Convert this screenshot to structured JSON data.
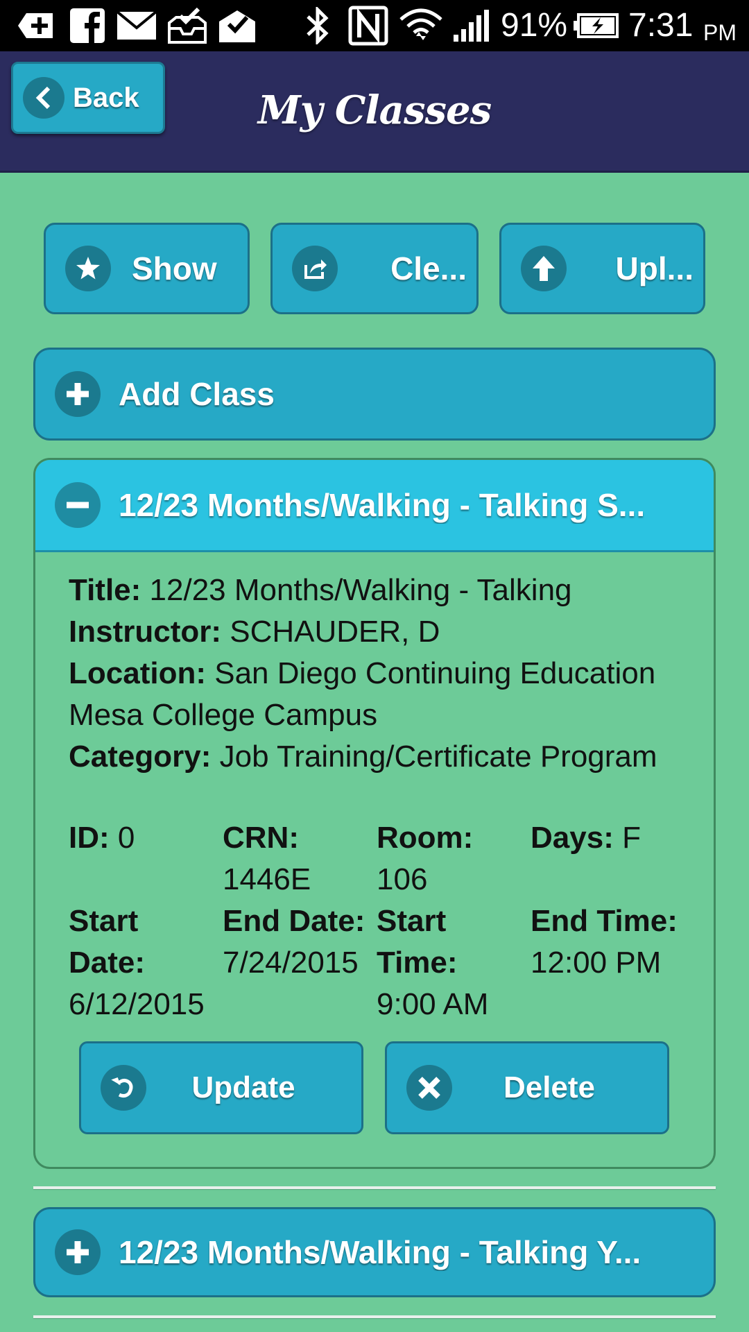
{
  "status_bar": {
    "battery_percent": "91%",
    "time": "7:31",
    "am_pm": "PM",
    "icons": [
      "add-box-icon",
      "facebook-icon",
      "mail-icon",
      "inbox-check-icon",
      "mail-check-icon",
      "bluetooth-icon",
      "nfc-icon",
      "wifi-icon",
      "signal-icon",
      "battery-charging-icon"
    ]
  },
  "header": {
    "back_label": "Back",
    "title": "My Classes"
  },
  "toolbar": {
    "show_label": "Show",
    "clear_label": "Cle...",
    "upload_label": "Upl..."
  },
  "add_class_label": "Add Class",
  "expanded_class": {
    "header": "12/23 Months/Walking - Talking  S...",
    "title_label": "Title:",
    "title_value": "12/23 Months/Walking - Talking",
    "instructor_label": "Instructor:",
    "instructor_value": "SCHAUDER, D",
    "location_label": "Location:",
    "location_value": "San Diego Continuing Education Mesa College Campus",
    "category_label": "Category:",
    "category_value": "Job Training/Certificate Program",
    "id_label": "ID:",
    "id_value": "0",
    "crn_label": "CRN:",
    "crn_value": "1446E",
    "room_label": "Room:",
    "room_value": "106",
    "days_label": "Days:",
    "days_value": "F",
    "start_date_label": "Start Date:",
    "start_date_value": "6/12/2015",
    "end_date_label": "End Date:",
    "end_date_value": "7/24/2015",
    "start_time_label": "Start Time:",
    "start_time_value": "9:00 AM",
    "end_time_label": "End Time:",
    "end_time_value": "12:00 PM",
    "update_label": "Update",
    "delete_label": "Delete"
  },
  "collapsed_class": {
    "header": "12/23 Months/Walking - Talking  Y..."
  },
  "colors": {
    "background": "#6dcb98",
    "header": "#2b2c5e",
    "button": "#26a9c6",
    "expanded_header": "#2bc3e1"
  }
}
